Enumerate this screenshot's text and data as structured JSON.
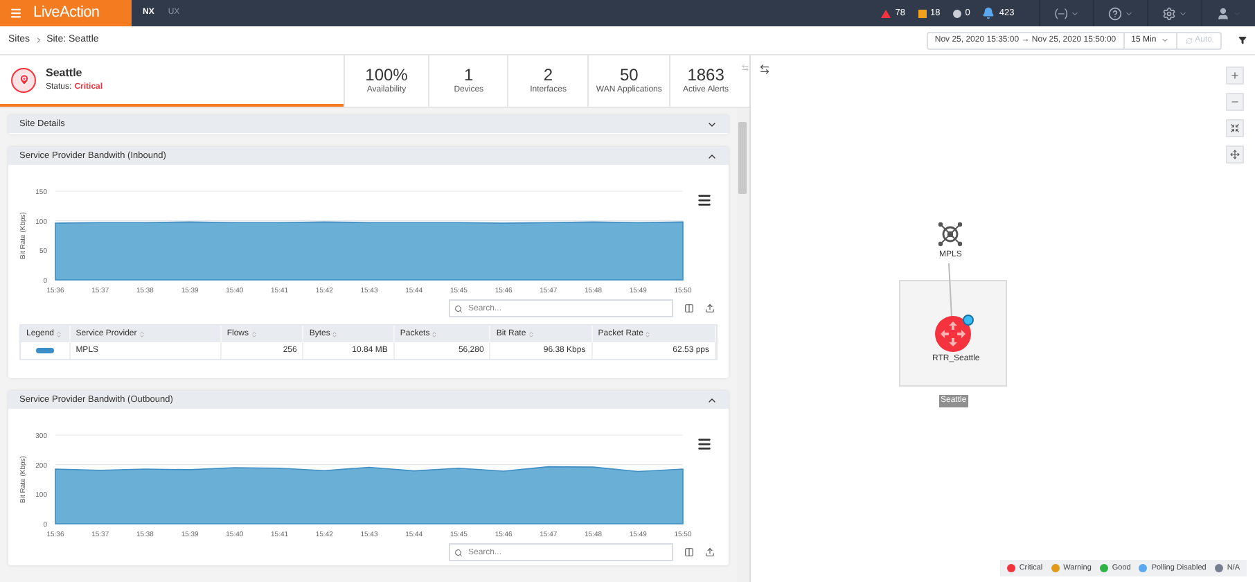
{
  "header": {
    "logo": "LiveAction",
    "modes": [
      {
        "label": "NX",
        "selected": true
      },
      {
        "label": "UX",
        "selected": false
      }
    ],
    "alerts": [
      {
        "kind": "critical",
        "count": "78"
      },
      {
        "kind": "warning",
        "count": "18"
      },
      {
        "kind": "info",
        "count": "0"
      },
      {
        "kind": "notifications",
        "count": "423"
      }
    ],
    "menus": [
      {
        "kind": "status",
        "label": "(–)"
      },
      {
        "kind": "help"
      },
      {
        "kind": "settings"
      },
      {
        "kind": "user"
      }
    ]
  },
  "breadcrumb": [
    "Sites",
    "Site: Seattle"
  ],
  "toolbar": {
    "time_range": "Nov 25, 2020 15:35:00 → Nov 25, 2020 15:50:00",
    "interval": "15 Min",
    "auto": {
      "label": "Auto",
      "disabled": true
    }
  },
  "site": {
    "name": "Seattle",
    "status_label": "Status:",
    "status": "Critical"
  },
  "stats": [
    {
      "value": "100%",
      "label": "Availability"
    },
    {
      "value": "1",
      "label": "Devices"
    },
    {
      "value": "2",
      "label": "Interfaces"
    },
    {
      "value": "50",
      "label": "WAN Applications"
    },
    {
      "value": "1863",
      "label": "Active Alerts"
    }
  ],
  "sections": [
    {
      "title": "Site Details",
      "expanded": false
    },
    {
      "title": "Service Provider Bandwith (Inbound)",
      "expanded": true,
      "search": {
        "placeholder": "Search..."
      },
      "chart_data": {
        "type": "area",
        "ylabel": "Bit Rate (Kbps)",
        "categories": [
          "15:36",
          "15:37",
          "15:38",
          "15:39",
          "15:40",
          "15:41",
          "15:42",
          "15:43",
          "15:44",
          "15:45",
          "15:46",
          "15:47",
          "15:48",
          "15:49",
          "15:50"
        ],
        "ylim": [
          0,
          150
        ],
        "yticks": [
          0,
          50,
          100,
          150
        ],
        "series": [
          {
            "color": "#6aafd6",
            "values": [
              96,
              97,
              97,
              98,
              97,
              97,
              98,
              97,
              97,
              97,
              96,
              97,
              98,
              97,
              98
            ]
          }
        ]
      },
      "table": {
        "columns": [
          "Legend",
          "Service Provider",
          "Flows",
          "Bytes",
          "Packets",
          "Bit Rate",
          "Packet Rate"
        ],
        "rows": [
          {
            "color": "#3b8fc8",
            "cells": [
              "",
              "MPLS",
              "256",
              "10.84 MB",
              "56,280",
              "96.38 Kbps",
              "62.53 pps"
            ]
          }
        ]
      }
    },
    {
      "title": "Service Provider Bandwith (Outbound)",
      "expanded": true,
      "search": {
        "placeholder": "Search..."
      },
      "chart_data": {
        "type": "area",
        "ylabel": "Bit Rate (Kbps)",
        "categories": [
          "15:36",
          "15:37",
          "15:38",
          "15:39",
          "15:40",
          "15:41",
          "15:42",
          "15:43",
          "15:44",
          "15:45",
          "15:46",
          "15:47",
          "15:48",
          "15:49",
          "15:50"
        ],
        "ylim": [
          0,
          300
        ],
        "yticks": [
          0,
          100,
          200,
          300
        ],
        "series": [
          {
            "color": "#6aafd6",
            "values": [
              185,
              181,
              185,
              183,
              190,
              188,
              180,
              191,
              179,
              188,
              178,
              193,
              192,
              177,
              185
            ]
          }
        ]
      }
    }
  ],
  "map": {
    "cloud": {
      "label": "MPLS"
    },
    "router": {
      "label": "RTR_Seattle",
      "color": "#f5333f"
    },
    "group": {
      "label": "Seattle"
    },
    "legend": [
      {
        "label": "Critical",
        "color": "#f5333f"
      },
      {
        "label": "Warning",
        "color": "#e29a1b"
      },
      {
        "label": "Good",
        "color": "#2fb344"
      },
      {
        "label": "Polling Disabled",
        "color": "#5aa9f0"
      },
      {
        "label": "N/A",
        "color": "#777e90"
      }
    ]
  }
}
